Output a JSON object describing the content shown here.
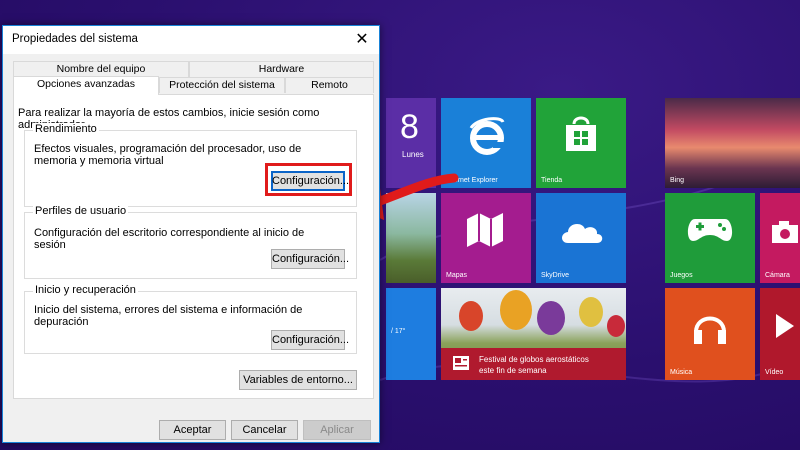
{
  "dialog": {
    "title": "Propiedades del sistema",
    "tabs_back": [
      "Nombre del equipo",
      "Hardware"
    ],
    "tabs_front": [
      "Opciones avanzadas",
      "Protección del sistema",
      "Remoto"
    ],
    "active_tab": "Opciones avanzadas",
    "intro": "Para realizar la mayoría de estos cambios, inicie sesión como administrador.",
    "groups": [
      {
        "title": "Rendimiento",
        "description": "Efectos visuales, programación del procesador, uso de memoria y memoria virtual",
        "button": "Configuración..."
      },
      {
        "title": "Perfiles de usuario",
        "description": "Configuración del escritorio correspondiente al inicio de sesión",
        "button": "Configuración..."
      },
      {
        "title": "Inicio y recuperación",
        "description": "Inicio del sistema, errores del sistema e información de depuración",
        "button": "Configuración..."
      }
    ],
    "env_button": "Variables de entorno...",
    "footer": {
      "ok": "Aceptar",
      "cancel": "Cancelar",
      "apply": "Aplicar"
    }
  },
  "start_screen": {
    "tiles": {
      "calendar_day": "8",
      "calendar_dayname": "Lunes",
      "ie": "Internet Explorer",
      "store": "Tienda",
      "bing": "Bing",
      "maps": "Mapas",
      "skydrive": "SkyDrive",
      "games": "Juegos",
      "camera": "Cámara",
      "weather_temp": "/ 17°",
      "festival_line1": "Festival de globos aerostáticos",
      "festival_line2": "este fin de semana",
      "music": "Música",
      "video": "Vídeo"
    }
  },
  "colors": {
    "highlight": "#e01b1b",
    "dialog_border": "#1883d7",
    "start_background": "#2a0f6e"
  }
}
